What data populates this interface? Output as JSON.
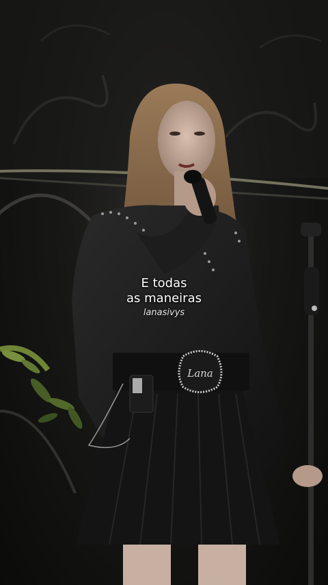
{
  "caption": {
    "line1": "E todas",
    "line2": "as maneiras",
    "handle": "lanasivys"
  },
  "belt_buckle_text": "Lana",
  "colors": {
    "background": "#0d0d0c",
    "caption_text": "#ffffff",
    "foliage": "#6f8a3a",
    "hair": "#8a6a48"
  }
}
